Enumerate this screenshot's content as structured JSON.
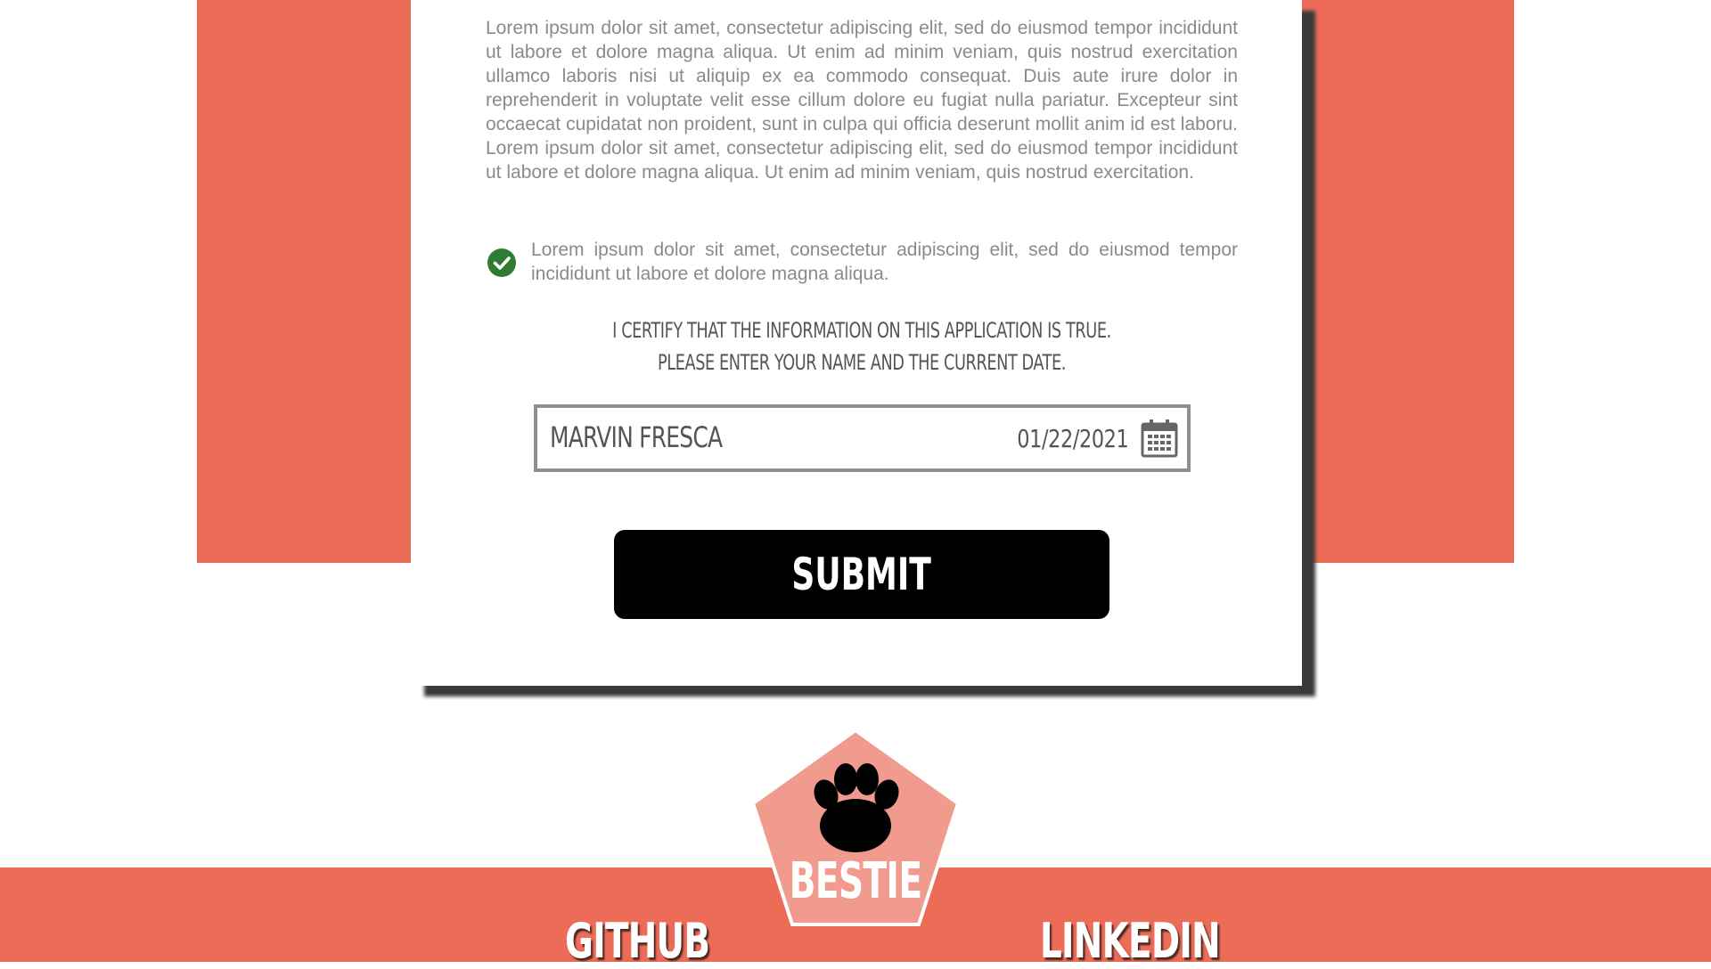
{
  "form": {
    "paragraph": "Lorem ipsum dolor sit amet, consectetur adipiscing elit, sed do eiusmod tempor incididunt ut labore et dolore magna aliqua. Ut enim ad minim veniam, quis nostrud exercitation ullamco laboris nisi ut aliquip ex ea commodo consequat. Duis aute irure dolor in reprehenderit in voluptate velit esse cillum dolore eu fugiat nulla pariatur. Excepteur sint occaecat cupidatat non proident, sunt in culpa qui officia deserunt mollit anim id est laboru. Lorem ipsum dolor sit amet, consectetur adipiscing elit, sed do eiusmod tempor incididunt ut labore et dolore magna aliqua. Ut enim ad minim veniam, quis nostrud exercitation.",
    "checkbox_text": "Lorem ipsum dolor sit amet, consectetur adipiscing elit, sed do eiusmod tempor incididunt ut labore et dolore magna aliqua.",
    "checkbox_checked": true,
    "certify_line1": "I CERTIFY THAT THE INFORMATION ON THIS APPLICATION IS TRUE.",
    "certify_line2": "PLEASE ENTER YOUR NAME AND THE CURRENT DATE.",
    "name_value": "MARVIN FRESCA",
    "date_value": "01/22/2021",
    "submit_label": "SUBMIT"
  },
  "footer": {
    "logo_text": "BESTIE",
    "github_label": "GITHUB",
    "linkedin_label": "LINKEDIN"
  },
  "colors": {
    "accent": "#ec6c58",
    "logo_fill": "#f19a8e",
    "check_green": "#2e7d32"
  },
  "icons": {
    "check": "check-circle-icon",
    "calendar": "calendar-icon",
    "logo": "paw-icon"
  }
}
